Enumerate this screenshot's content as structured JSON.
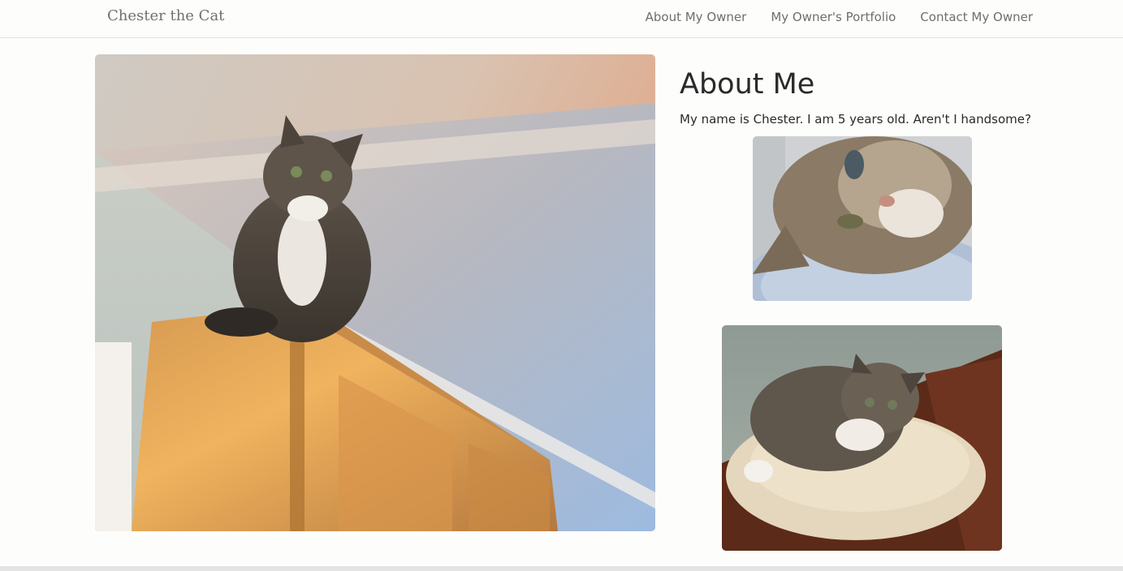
{
  "navbar": {
    "brand": "Chester the Cat",
    "links": [
      {
        "label": "About My Owner"
      },
      {
        "label": "My Owner's Portfolio"
      },
      {
        "label": "Contact My Owner"
      }
    ]
  },
  "about": {
    "heading": "About Me",
    "text": "My name is Chester. I am 5 years old. Aren't I handsome?"
  },
  "photos": {
    "main": {
      "alt": "Cat sitting on top of a wooden wardrobe"
    },
    "small1": {
      "alt": "Cat resting head on pillow"
    },
    "small2": {
      "alt": "Cat curled up on a cushion"
    }
  }
}
